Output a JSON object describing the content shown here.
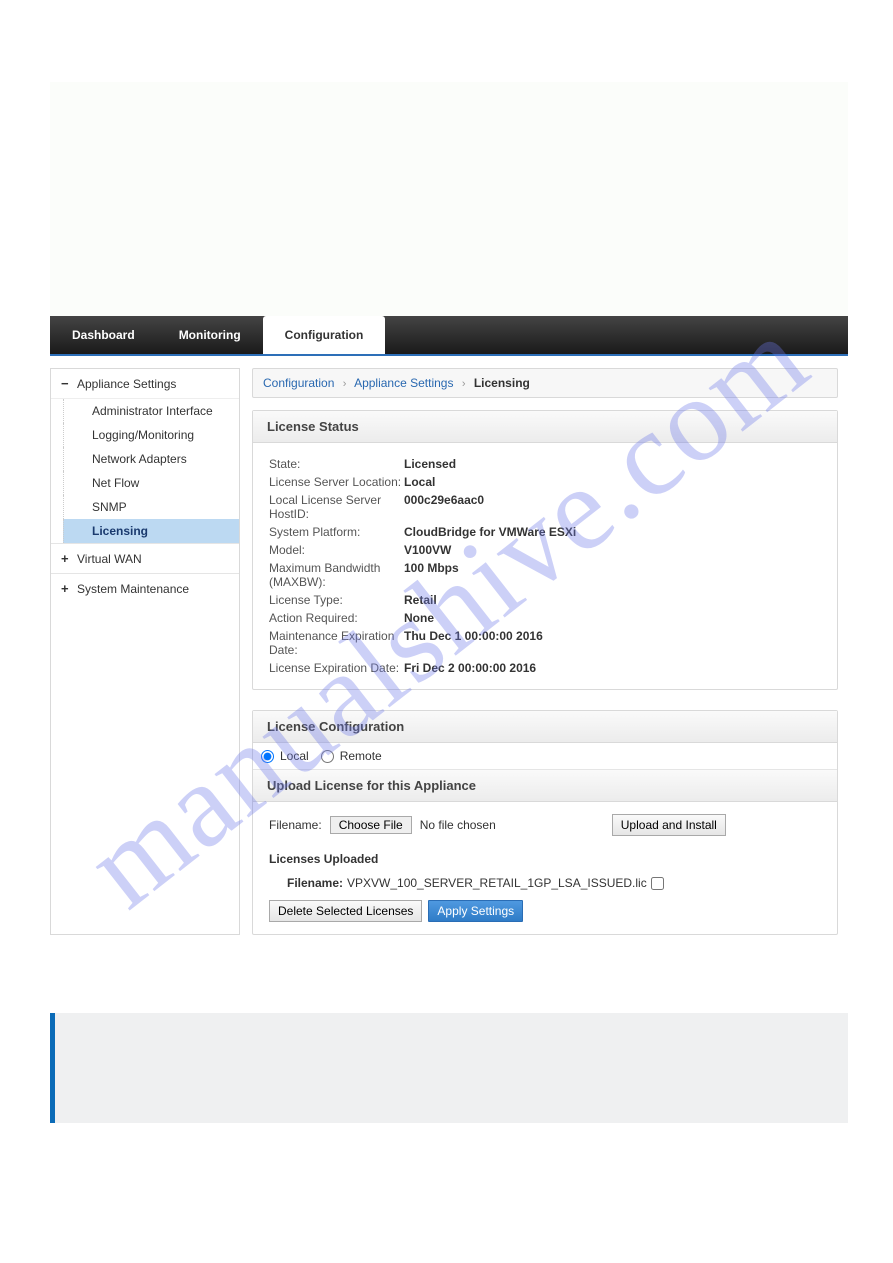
{
  "watermark": "manualshive.com",
  "tabs": {
    "dashboard": "Dashboard",
    "monitoring": "Monitoring",
    "configuration": "Configuration"
  },
  "sidebar": {
    "section_appliance": "Appliance Settings",
    "section_virtualwan": "Virtual WAN",
    "section_sysmaint": "System Maintenance",
    "items": [
      "Administrator Interface",
      "Logging/Monitoring",
      "Network Adapters",
      "Net Flow",
      "SNMP",
      "Licensing"
    ]
  },
  "breadcrumb": {
    "a": "Configuration",
    "b": "Appliance Settings",
    "c": "Licensing"
  },
  "status": {
    "title": "License Status",
    "rows": {
      "state_k": "State:",
      "state_v": "Licensed",
      "loc_k": "License Server Location:",
      "loc_v": "Local",
      "hostid_k": "Local License Server HostID:",
      "hostid_v": "000c29e6aac0",
      "platform_k": "System Platform:",
      "platform_v": "CloudBridge for VMWare ESXi",
      "model_k": "Model:",
      "model_v": "V100VW",
      "maxbw_k": "Maximum Bandwidth (MAXBW):",
      "maxbw_v": "100 Mbps",
      "lictype_k": "License Type:",
      "lictype_v": "Retail",
      "action_k": "Action Required:",
      "action_v": "None",
      "maint_k": "Maintenance Expiration Date:",
      "maint_v": "Thu Dec 1 00:00:00 2016",
      "licexp_k": "License Expiration Date:",
      "licexp_v": "Fri Dec 2 00:00:00 2016"
    }
  },
  "config": {
    "title": "License Configuration",
    "radio_local": "Local",
    "radio_remote": "Remote",
    "upload_title": "Upload License for this Appliance",
    "filename_label": "Filename:",
    "choose_file": "Choose File",
    "no_file": "No file chosen",
    "upload_install": "Upload and Install",
    "licenses_uploaded": "Licenses Uploaded",
    "uploaded_filename_label": "Filename:",
    "uploaded_filename": "VPXVW_100_SERVER_RETAIL_1GP_LSA_ISSUED.lic",
    "delete_selected": "Delete Selected Licenses",
    "apply_settings": "Apply Settings"
  }
}
